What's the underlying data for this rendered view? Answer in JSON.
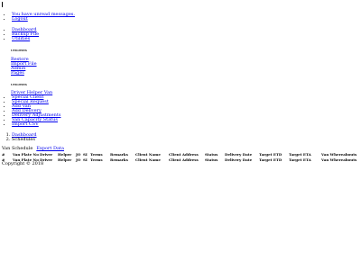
{
  "top_links": [
    "You have unread messages.",
    "Logout"
  ],
  "nav": {
    "dashboard": "Dashboard",
    "backup": "Backup File",
    "utilities": "Utilities"
  },
  "utilities_heading_1": "UTILITIES",
  "utility_links": [
    "Restore",
    "Import File",
    "Admin",
    "Pages"
  ],
  "utilities_heading_2": "UTILITIES",
  "driver_helper_van": "Driver Helper Van",
  "sub_links": [
    "Special Client",
    "Special Request",
    "Add Van",
    "Add Delivery",
    "Delivery Adjustments",
    "Van Capacity Status",
    "Import CSV"
  ],
  "breadcrumbs": [
    "Dashboard",
    "Schedules"
  ],
  "page_title": "Van Schedule",
  "export_label": "Export Data",
  "table": {
    "columns": [
      "#",
      "Van Plate No",
      "Driver",
      "Helper",
      "JO",
      "SI",
      "Terms",
      "Remarks",
      "Client Name",
      "Client Address",
      "Status",
      "Delivery Date",
      "Target ETD",
      "Target ETA",
      "Van Whereabouts"
    ],
    "rows": [
      [
        "#",
        "Van Plate No",
        "Driver",
        "Helper",
        "JO",
        "SI",
        "Terms",
        "Remarks",
        "Client Name",
        "Client Address",
        "Status",
        "Delivery Date",
        "Target ETD",
        "Target ETA",
        "Van Whereabouts"
      ]
    ]
  },
  "copyright": "Copyright © 2018"
}
